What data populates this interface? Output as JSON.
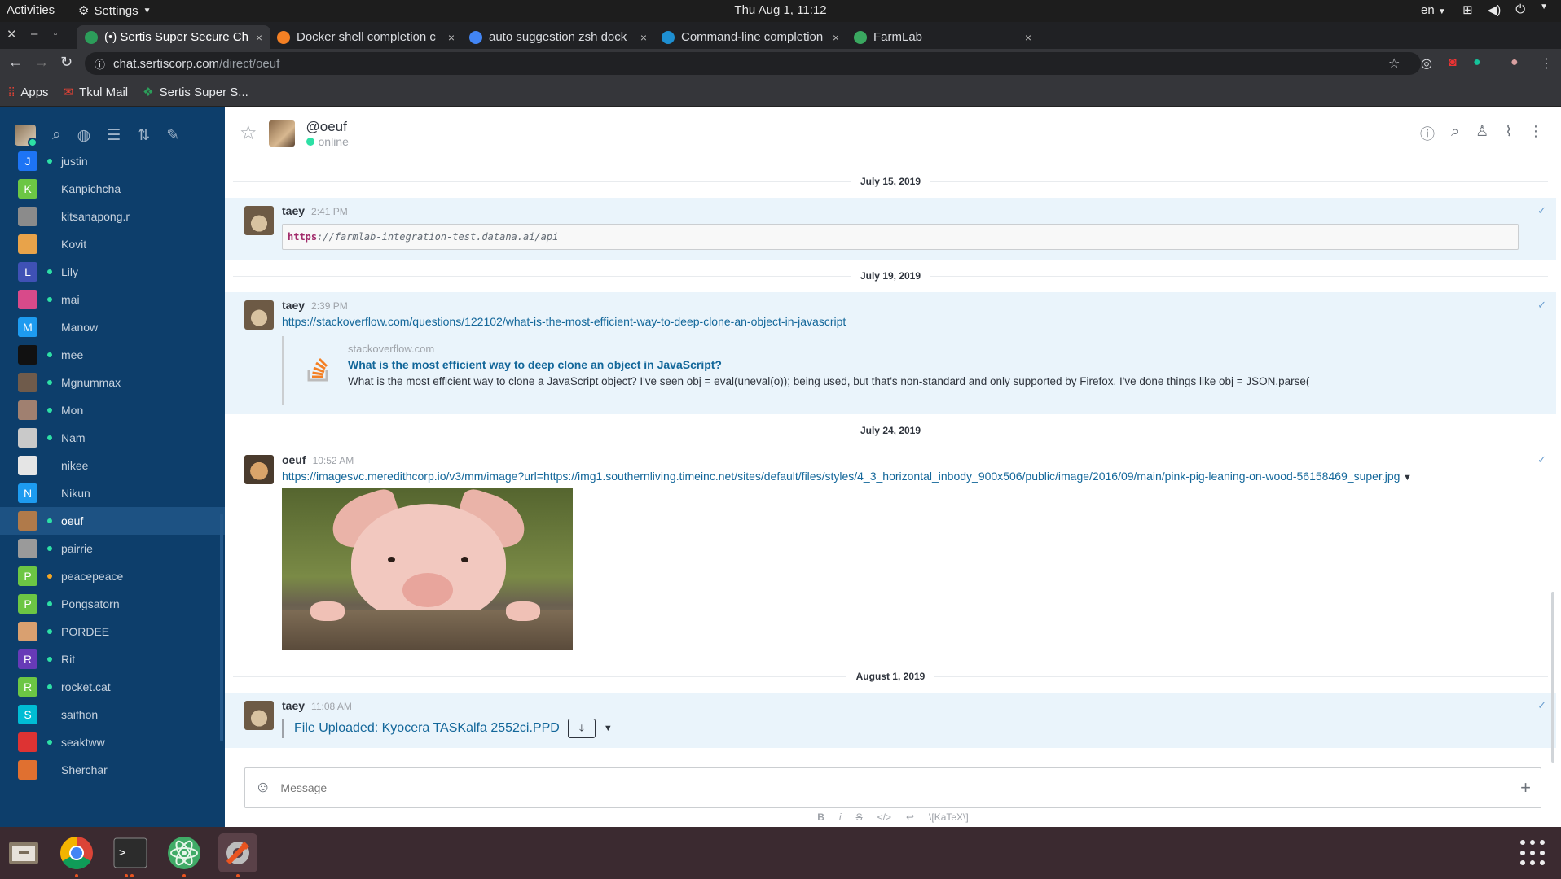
{
  "gnome": {
    "activities": "Activities",
    "settings_menu": "Settings",
    "clock": "Thu Aug  1, 11:12",
    "lang": "en"
  },
  "browser": {
    "tabs": [
      {
        "title": "(•) Sertis Super Secure Ch",
        "close": "×",
        "favicon_color": "#2c9d5a"
      },
      {
        "title": "Docker shell completion c",
        "close": "×",
        "favicon_color": "#f48024"
      },
      {
        "title": "auto suggestion zsh dock",
        "close": "×",
        "favicon_color": "#4285f4"
      },
      {
        "title": "Command-line completion",
        "close": "×",
        "favicon_color": "#1e8fd1"
      },
      {
        "title": "FarmLab",
        "close": "×",
        "favicon_color": "#3aa860"
      }
    ],
    "url_host": "chat.sertiscorp.com",
    "url_path": "/direct/oeuf",
    "bookmarks": [
      "Apps",
      "Tkul Mail",
      "Sertis Super S..."
    ]
  },
  "sidebar": {
    "users": [
      {
        "name": "justin",
        "initial": "J",
        "color": "#1d74f5",
        "status": "#2de0a5"
      },
      {
        "name": "Kanpichcha",
        "initial": "K",
        "color": "#6cc644",
        "status": ""
      },
      {
        "name": "kitsanapong.r",
        "initial": "",
        "color": "#8b8b8b",
        "status": ""
      },
      {
        "name": "Kovit",
        "initial": "",
        "color": "#e8a34a",
        "status": ""
      },
      {
        "name": "Lily",
        "initial": "L",
        "color": "#3f51b5",
        "status": "#2de0a5"
      },
      {
        "name": "mai",
        "initial": "",
        "color": "#d84a8a",
        "status": "#2de0a5"
      },
      {
        "name": "Manow",
        "initial": "M",
        "color": "#1d9bf0",
        "status": ""
      },
      {
        "name": "mee",
        "initial": "",
        "color": "#111111",
        "status": "#2de0a5"
      },
      {
        "name": "Mgnummax",
        "initial": "",
        "color": "#6f5b4b",
        "status": "#2de0a5"
      },
      {
        "name": "Mon",
        "initial": "",
        "color": "#a08070",
        "status": "#2de0a5"
      },
      {
        "name": "Nam",
        "initial": "",
        "color": "#c9c9c9",
        "status": "#2de0a5"
      },
      {
        "name": "nikee",
        "initial": "",
        "color": "#e5e5e5",
        "status": ""
      },
      {
        "name": "Nikun",
        "initial": "N",
        "color": "#1d9bf0",
        "status": ""
      },
      {
        "name": "oeuf",
        "initial": "",
        "color": "#b07a4a",
        "status": "#2de0a5",
        "selected": true
      },
      {
        "name": "pairrie",
        "initial": "",
        "color": "#9a9a9a",
        "status": "#2de0a5"
      },
      {
        "name": "peacepeace",
        "initial": "P",
        "color": "#6cc644",
        "status": "#f5a623"
      },
      {
        "name": "Pongsatorn",
        "initial": "P",
        "color": "#6cc644",
        "status": "#2de0a5"
      },
      {
        "name": "PORDEE",
        "initial": "",
        "color": "#d9a070",
        "status": "#2de0a5"
      },
      {
        "name": "Rit",
        "initial": "R",
        "color": "#673ab7",
        "status": "#2de0a5"
      },
      {
        "name": "rocket.cat",
        "initial": "R",
        "color": "#6cc644",
        "status": "#2de0a5"
      },
      {
        "name": "saifhon",
        "initial": "S",
        "color": "#00bcd4",
        "status": ""
      },
      {
        "name": "seaktww",
        "initial": "",
        "color": "#d33",
        "status": "#2de0a5"
      },
      {
        "name": "Sherchar",
        "initial": "",
        "color": "#e07030",
        "status": ""
      }
    ]
  },
  "room": {
    "name": "@oeuf",
    "status": "online"
  },
  "messages": {
    "d1": "July 15, 2019",
    "m1": {
      "user": "taey",
      "time": "2:41 PM",
      "code_scheme": "https",
      "code_rest": "://farmlab-integration-test.datana.ai/api"
    },
    "d2": "July 19, 2019",
    "m2": {
      "user": "taey",
      "time": "2:39 PM",
      "link": "https://stackoverflow.com/questions/122102/what-is-the-most-efficient-way-to-deep-clone-an-object-in-javascript",
      "site": "stackoverflow.com",
      "title": "What is the most efficient way to deep clone an object in JavaScript?",
      "desc": "What is the most efficient way to clone a JavaScript object? I've seen obj = eval(uneval(o)); being used, but that's non-standard and only supported by Firefox. I've done things like obj = JSON.parse("
    },
    "d3": "July 24, 2019",
    "m3": {
      "user": "oeuf",
      "time": "10:52 AM",
      "link": "https://imagesvc.meredithcorp.io/v3/mm/image?url=https://img1.southernliving.timeinc.net/sites/default/files/styles/4_3_horizontal_inbody_900x506/public/image/2016/09/main/pink-pig-leaning-on-wood-56158469_super.jpg"
    },
    "d4": "August 1, 2019",
    "m4": {
      "user": "taey",
      "time": "11:08 AM",
      "file": "File Uploaded: Kyocera TASKalfa 2552ci.PPD"
    }
  },
  "composer": {
    "placeholder": "Message",
    "format": [
      "B",
      "i",
      "S",
      "</>",
      "↩",
      "\\[KaTeX\\]"
    ]
  }
}
